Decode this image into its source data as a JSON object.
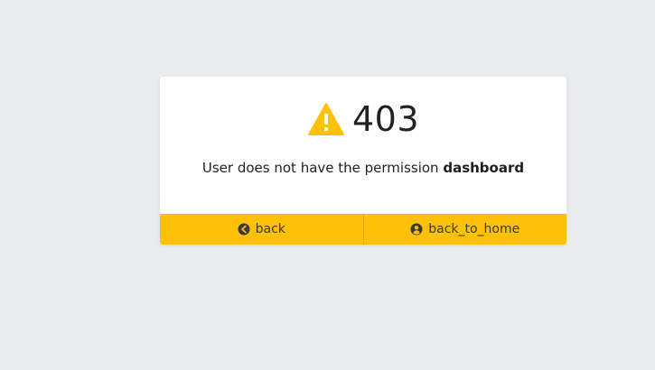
{
  "error": {
    "code": "403",
    "message_prefix": "User does not have the permission ",
    "permission": "dashboard"
  },
  "actions": {
    "back_label": "back",
    "home_label": "back_to_home"
  },
  "colors": {
    "accent": "#ffc107",
    "background": "#e9ebee",
    "card": "#ffffff",
    "text": "#222222"
  },
  "icons": {
    "warning": "warning-triangle-icon",
    "back": "arrow-left-circle-icon",
    "home": "user-circle-icon"
  }
}
